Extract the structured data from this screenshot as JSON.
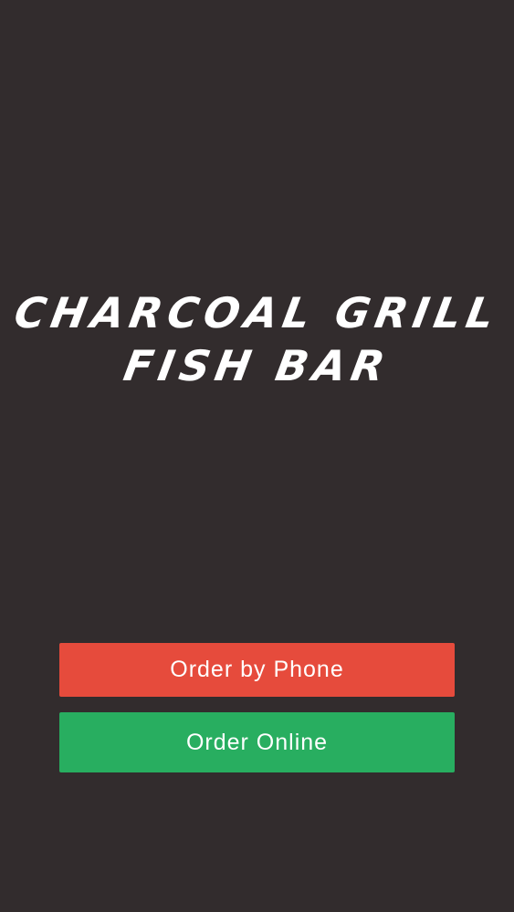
{
  "app": {
    "background_color": "#322c2d"
  },
  "logo": {
    "line1": "CHARCOAL GRILL",
    "line2": "FISH BAR",
    "color": "#ffffff"
  },
  "actions": {
    "order_by_phone": {
      "label": "Order by Phone",
      "color": "#e64b3c"
    },
    "order_online": {
      "label": "Order Online",
      "color": "#28ae60"
    }
  }
}
